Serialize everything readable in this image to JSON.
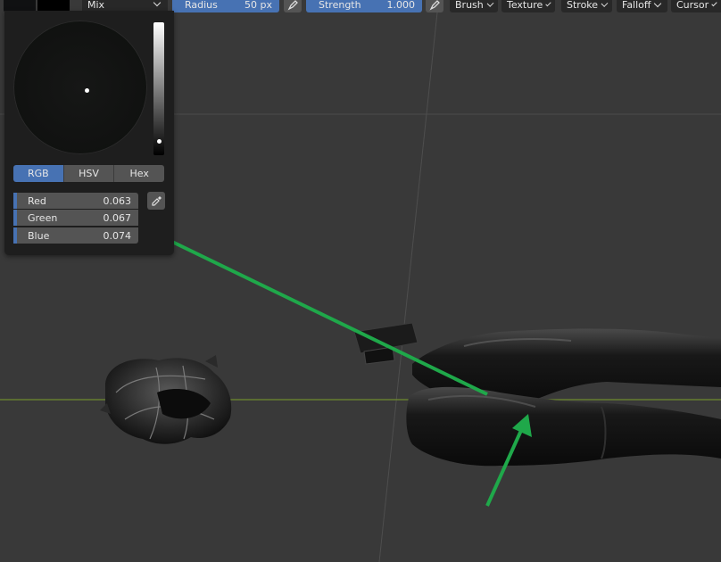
{
  "toolbar": {
    "blend_mode": "Mix",
    "radius_label": "Radius",
    "radius_value": "50 px",
    "strength_label": "Strength",
    "strength_value": "1.000",
    "menus": [
      "Brush",
      "Texture",
      "Stroke",
      "Falloff",
      "Cursor"
    ]
  },
  "color_picker": {
    "modes": [
      "RGB",
      "HSV",
      "Hex"
    ],
    "active_mode": "RGB",
    "channels": [
      {
        "name": "Red",
        "value": "0.063"
      },
      {
        "name": "Green",
        "value": "0.067"
      },
      {
        "name": "Blue",
        "value": "0.074"
      }
    ],
    "value_slider_level": 0.07
  },
  "colors": {
    "accent": "#4772b3",
    "annotation_arrow": "#1fa84a",
    "horizon_line": "#6f8a2f",
    "background": "#393939"
  }
}
